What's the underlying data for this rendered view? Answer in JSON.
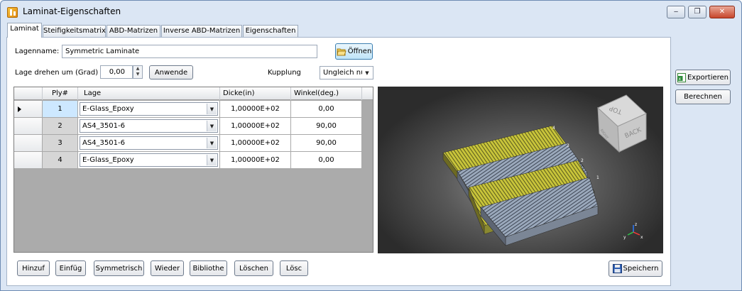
{
  "window": {
    "title": "Laminat-Eigenschaften",
    "controls": [
      "‒",
      "❐",
      "✕"
    ]
  },
  "tabs": [
    "Laminat",
    "Steifigkeitsmatrix",
    "ABD-Matrizen",
    "Inverse ABD-Matrizen",
    "Eigenschaften"
  ],
  "form": {
    "lagenname_label": "Lagenname:",
    "lagenname_value": "Symmetric Laminate",
    "oeffnen_button": "Öffnen",
    "rotate_label": "Lage drehen um (Grad)",
    "rotate_value": "0,00",
    "anwende_button": "Anwende",
    "kupplung_label": "Kupplung",
    "kupplung_value": "Ungleich nu"
  },
  "table": {
    "columns": [
      "Ply#",
      "Lage",
      "Dicke(in)",
      "Winkel(deg.)"
    ],
    "rows": [
      {
        "ply": "1",
        "lage": "E-Glass_Epoxy",
        "dicke": "1,00000E+02",
        "winkel": "0,00"
      },
      {
        "ply": "2",
        "lage": "AS4_3501-6",
        "dicke": "1,00000E+02",
        "winkel": "90,00"
      },
      {
        "ply": "3",
        "lage": "AS4_3501-6",
        "dicke": "1,00000E+02",
        "winkel": "90,00"
      },
      {
        "ply": "4",
        "lage": "E-Glass_Epoxy",
        "dicke": "1,00000E+02",
        "winkel": "0,00"
      }
    ],
    "selected_row": 0
  },
  "viewer": {
    "viewcube_top": "TOP",
    "viewcube_back": "BACK",
    "viewcube_right": "RIGHT",
    "ply_labels": [
      "1",
      "2",
      "3",
      "4"
    ],
    "axes": [
      "x",
      "y",
      "z"
    ]
  },
  "bottom_buttons": [
    "Hinzuf",
    "Einfüg",
    "Symmetrisch",
    "Wieder",
    "Bibliothe",
    "Löschen",
    "Lösc"
  ],
  "speichern_button": "Speichern",
  "side_buttons": {
    "exportieren": "Exportieren",
    "berechnen": "Berechnen"
  },
  "colors": {
    "glass_ply": "#c8c43a",
    "carbon_ply": "#9aa8bb",
    "selected_cell": "#cde8ff"
  }
}
